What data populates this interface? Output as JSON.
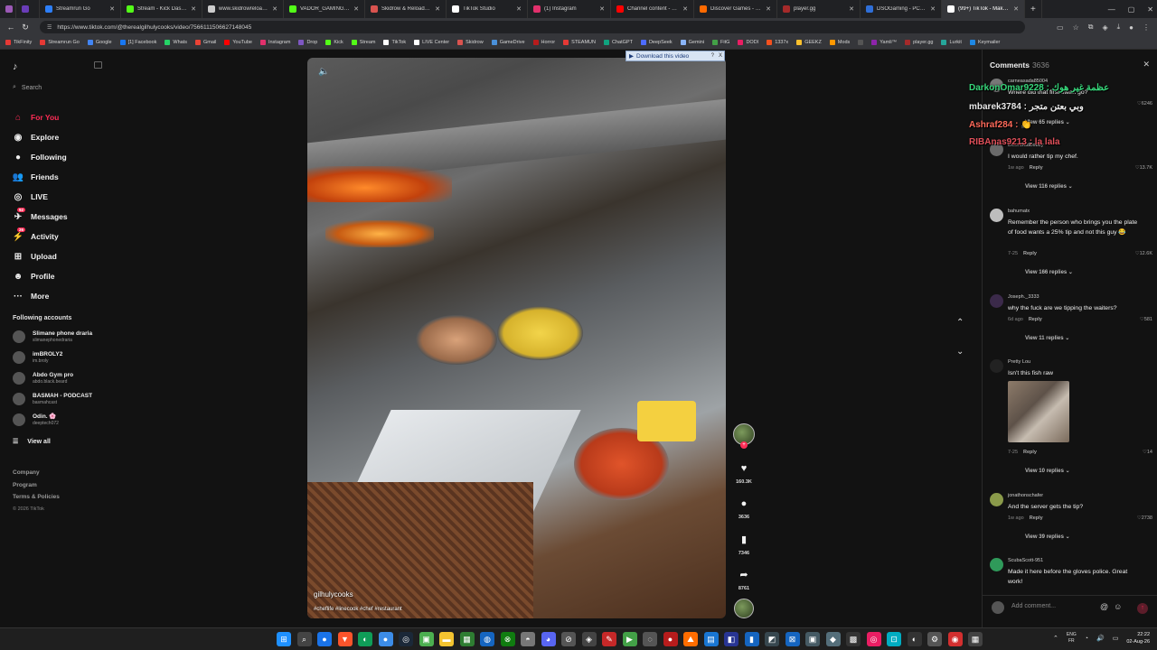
{
  "browser": {
    "tabs": [
      {
        "label": "",
        "color": "#9b59b6",
        "active": false
      },
      {
        "label": "",
        "color": "#6a3db8",
        "active": false
      },
      {
        "label": "Streamrun Go",
        "color": "#2d7ff9",
        "active": false
      },
      {
        "label": "Stream - Kick Dashboard",
        "color": "#53fc18",
        "active": false
      },
      {
        "label": "www.skidrowreloaded...",
        "color": "#cccccc",
        "active": false
      },
      {
        "label": "VADOR_GAMING Stre...",
        "color": "#53fc18",
        "active": false
      },
      {
        "label": "Skidrow & Reloaded G...",
        "color": "#d9534f",
        "active": false
      },
      {
        "label": "TikTok Studio",
        "color": "#ffffff",
        "active": false
      },
      {
        "label": "(1) Instagram",
        "color": "#e1306c",
        "active": false
      },
      {
        "label": "Channel content - You...",
        "color": "#ff0000",
        "active": false
      },
      {
        "label": "Discover Games - Keyn...",
        "color": "#ff6a00",
        "active": false
      },
      {
        "label": "player.gg",
        "color": "#a52a2a",
        "active": false
      },
      {
        "label": "DSOGaming - PC Gam...",
        "color": "#2f6fd8",
        "active": false
      },
      {
        "label": "(99+) TikTok - Make...",
        "color": "#ffffff",
        "active": true
      }
    ],
    "url": "https://www.tiktok.com/@therealgilhulycooks/video/7566111506627148045",
    "bookmarks": [
      {
        "label": "TikFinity",
        "color": "#e53935"
      },
      {
        "label": "Streamrun Go",
        "color": "#e53935"
      },
      {
        "label": "Google",
        "color": "#4285f4"
      },
      {
        "label": "[1] Facebook",
        "color": "#1877f2"
      },
      {
        "label": "Whats",
        "color": "#25d366"
      },
      {
        "label": "Gmail",
        "color": "#ea4335"
      },
      {
        "label": "YouTube",
        "color": "#ff0000"
      },
      {
        "label": "Instagram",
        "color": "#e1306c"
      },
      {
        "label": "Drop",
        "color": "#7e57c2"
      },
      {
        "label": "Kick",
        "color": "#53fc18"
      },
      {
        "label": "Stream",
        "color": "#53fc18"
      },
      {
        "label": "TikTok",
        "color": "#ffffff"
      },
      {
        "label": "LIVE Center",
        "color": "#ffffff"
      },
      {
        "label": "Skidrow",
        "color": "#d9534f"
      },
      {
        "label": "GameDrive",
        "color": "#4a90d9"
      },
      {
        "label": "Horror",
        "color": "#b71c1c"
      },
      {
        "label": "STEAMUN",
        "color": "#e53935"
      },
      {
        "label": "ChatGPT",
        "color": "#10a37f"
      },
      {
        "label": "DeepSeek",
        "color": "#4d6bfe"
      },
      {
        "label": "Gemini",
        "color": "#8ab4f8"
      },
      {
        "label": "FitG",
        "color": "#43a047"
      },
      {
        "label": "DODI",
        "color": "#e91e63"
      },
      {
        "label": "1337x",
        "color": "#f4511e"
      },
      {
        "label": "GEEKZ",
        "color": "#fbc02d"
      },
      {
        "label": "Mods",
        "color": "#ff9800"
      },
      {
        "label": "",
        "color": "#555555"
      },
      {
        "label": "Yamli™",
        "color": "#8e24aa"
      },
      {
        "label": "player.gg",
        "color": "#a52a2a"
      },
      {
        "label": "Lurkit",
        "color": "#26a69a"
      },
      {
        "label": "Keymailer",
        "color": "#1e88e5"
      }
    ]
  },
  "sidebar": {
    "logo": "♪",
    "search_placeholder": "Search",
    "nav": [
      {
        "label": "For You",
        "icon": "home-icon",
        "glyph": "⌂",
        "active": true,
        "badge": ""
      },
      {
        "label": "Explore",
        "icon": "compass-icon",
        "glyph": "◉",
        "active": false,
        "badge": ""
      },
      {
        "label": "Following",
        "icon": "following-icon",
        "glyph": "●",
        "active": false,
        "badge": ""
      },
      {
        "label": "Friends",
        "icon": "friends-icon",
        "glyph": "👥",
        "active": false,
        "badge": ""
      },
      {
        "label": "LIVE",
        "icon": "live-icon",
        "glyph": "◎",
        "active": false,
        "badge": ""
      },
      {
        "label": "Messages",
        "icon": "messages-icon",
        "glyph": "✈",
        "active": false,
        "badge": "92"
      },
      {
        "label": "Activity",
        "icon": "activity-icon",
        "glyph": "⚡",
        "active": false,
        "badge": "26"
      },
      {
        "label": "Upload",
        "icon": "upload-icon",
        "glyph": "⊞",
        "active": false,
        "badge": ""
      },
      {
        "label": "Profile",
        "icon": "profile-icon",
        "glyph": "☻",
        "active": false,
        "badge": ""
      },
      {
        "label": "More",
        "icon": "more-icon",
        "glyph": "···",
        "active": false,
        "badge": ""
      }
    ],
    "following_title": "Following accounts",
    "accounts": [
      {
        "name": "Slimane phone draria",
        "handle": "slimanephonedraria"
      },
      {
        "name": "imBROLY2",
        "handle": "im.broly"
      },
      {
        "name": "Abdo Gym pro",
        "handle": "abdo.black.beard"
      },
      {
        "name": "BASMAH - PODCAST",
        "handle": "basmahcast"
      },
      {
        "name": "Odin. 🌸",
        "handle": "deeptech072"
      }
    ],
    "view_all": "View all",
    "footer": {
      "company": "Company",
      "program": "Program",
      "terms": "Terms & Policies",
      "copyright": "© 2026 TikTok"
    }
  },
  "video": {
    "author": "gilhulycooks",
    "hashtags": "#cheflife #linecook #chef #restaurant",
    "download_label": "Download this video",
    "download_help": "?",
    "download_close": "X"
  },
  "actions": {
    "likes": "160.3K",
    "comments": "3636",
    "saves": "7346",
    "shares": "8761"
  },
  "comments": {
    "title": "Comments",
    "count": "3636",
    "list": [
      {
        "user": "carneasada85004",
        "text": "Where did that first steak go?",
        "time": "",
        "reply": "",
        "likes": "6246",
        "replies": "View 65 replies"
      },
      {
        "user": "DownBadBobby",
        "text": "I would rather tip my chef.",
        "time": "1w ago",
        "reply": "Reply",
        "likes": "13.7K",
        "replies": "View 116 replies"
      },
      {
        "user": "bahumatx",
        "text": "Remember the person who brings you the plate of food wants a 25% tip and not this guy 😂",
        "time": "7-25",
        "reply": "Reply",
        "likes": "12.6K",
        "replies": "View 166 replies"
      },
      {
        "user": "Joseph._3333",
        "text": "why the fuck are we tipping the waiters?",
        "time": "6d ago",
        "reply": "Reply",
        "likes": "581",
        "replies": "View 11 replies"
      },
      {
        "user": "Pretty Lou",
        "text": "Isn't this fish raw",
        "time": "7-25",
        "reply": "Reply",
        "likes": "14",
        "replies": "View 10 replies"
      },
      {
        "user": "jonathonschafer",
        "text": "And the server gets the tip?",
        "time": "1w ago",
        "reply": "Reply",
        "likes": "2738",
        "replies": "View 39 replies"
      },
      {
        "user": "ScubaScott-951",
        "text": "Made it here before the gloves police. Great work!",
        "time": "",
        "reply": "",
        "likes": "",
        "replies": ""
      }
    ],
    "input_placeholder": "Add comment..."
  },
  "chat_overlay": [
    {
      "text": "DarkonOmar9228 : عظمة غير هوك",
      "color": "#37d67a"
    },
    {
      "text": "mbarek3784 : وبي بعتن متجر",
      "color": "#e8e8e8"
    },
    {
      "text": "Ashraf284 : 👏",
      "color": "#ff6a5a"
    },
    {
      "text": "RIBAnas9213 : la lala",
      "color": "#e0505a"
    }
  ],
  "taskbar": {
    "lang_top": "ENG",
    "lang_bottom": "FR",
    "time": "22:22",
    "date": "02-Aug-26"
  }
}
